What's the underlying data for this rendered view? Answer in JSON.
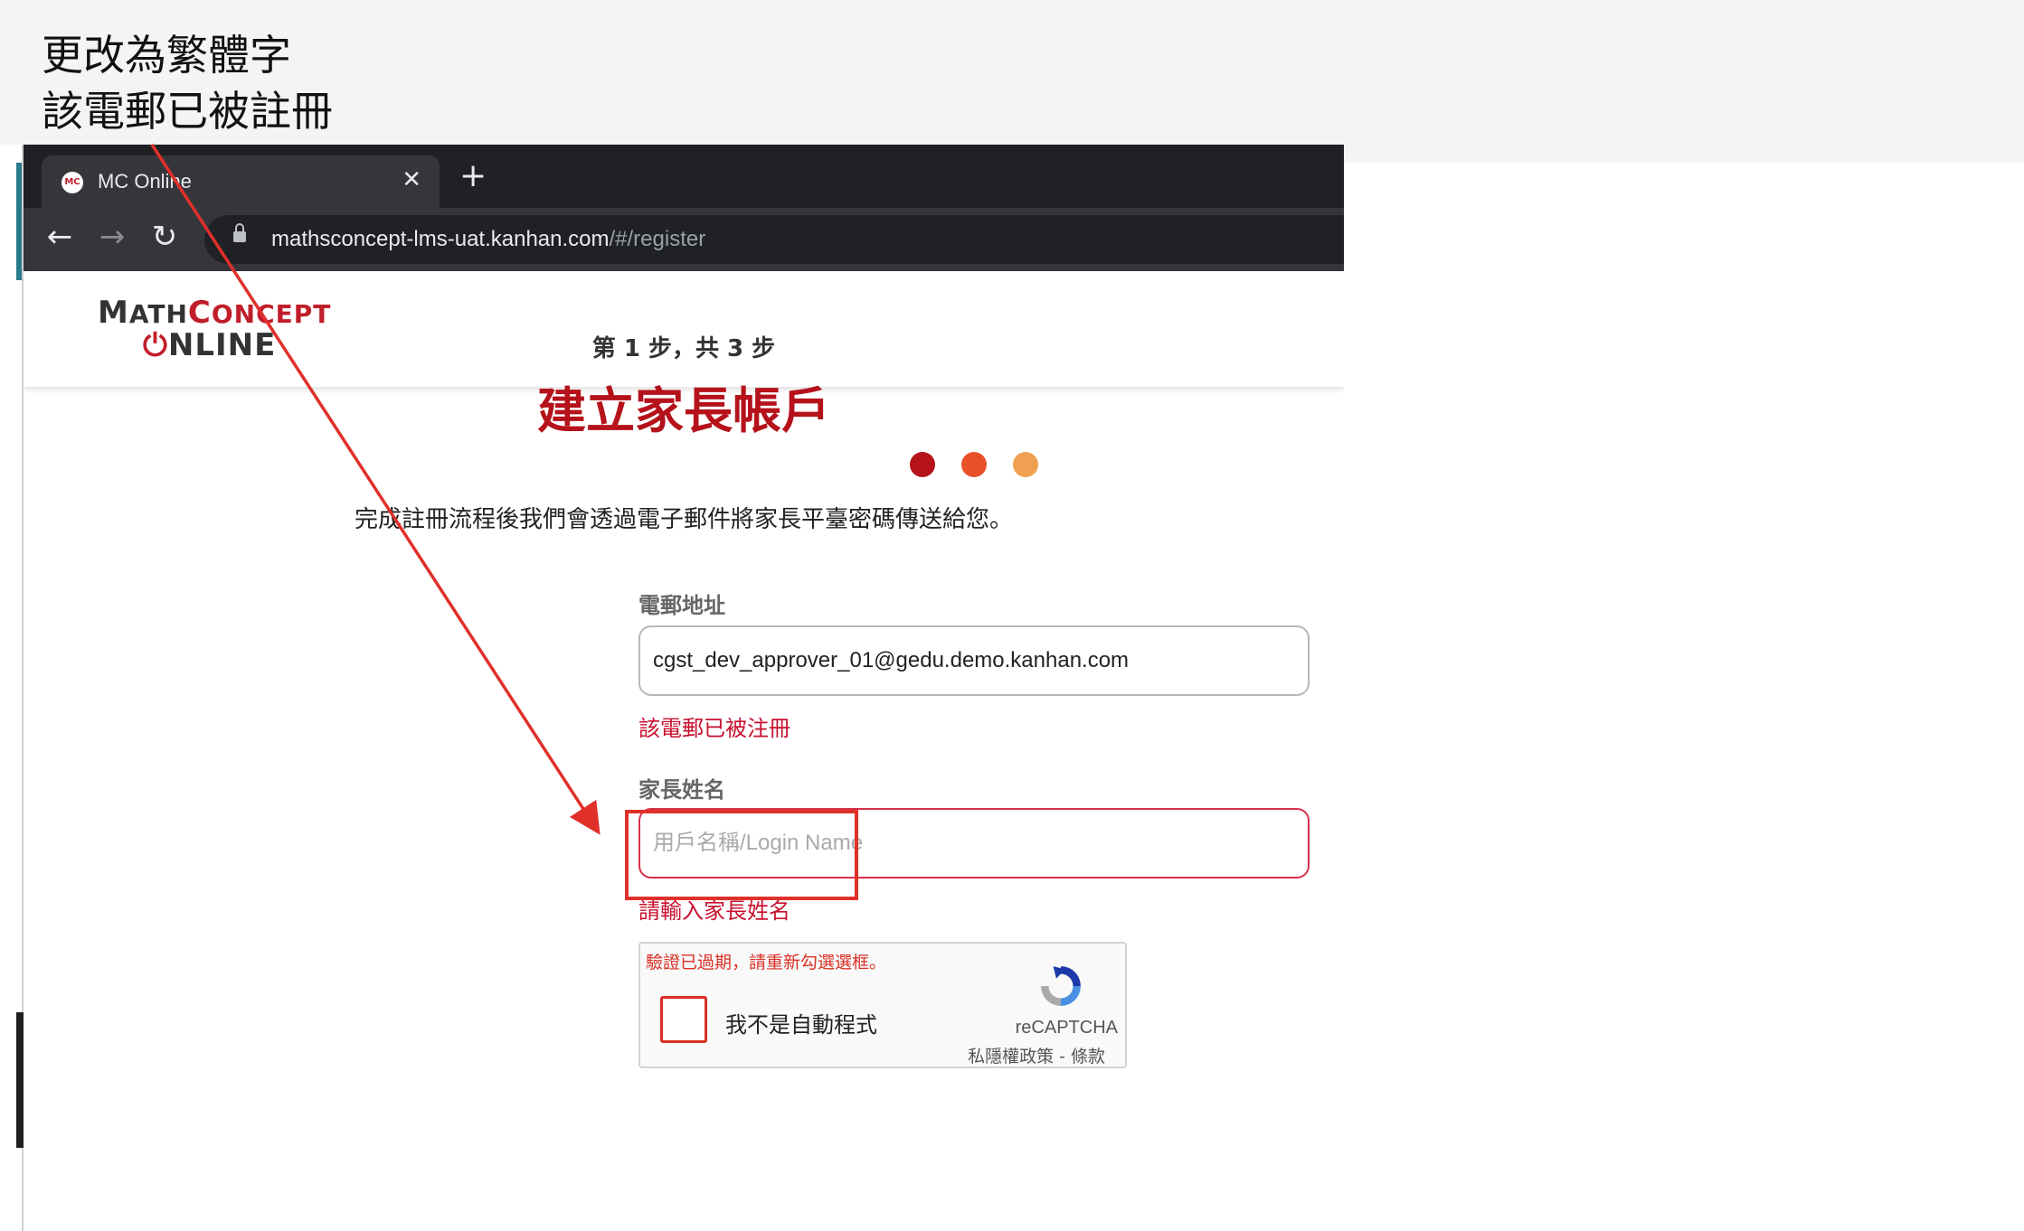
{
  "annotation": {
    "lines": [
      "更改為繁體字",
      "該電郵已被註冊"
    ]
  },
  "browser": {
    "tab_title": "MC Online",
    "favicon_text": "MC",
    "tab_close": "✕",
    "new_tab": "+",
    "url_host": "mathsconcept-lms-uat.kanhan.com",
    "url_path": "/#/register",
    "back": "←",
    "forward": "→",
    "reload": "↻"
  },
  "logo": {
    "line1_a": "M",
    "line1_b": "ATH",
    "line1_c": "C",
    "line1_d": "ONCEPT",
    "power": "⏻",
    "line2": "NLINE"
  },
  "form": {
    "step": "第 1 步，共 3 步",
    "title": "建立家長帳戶",
    "subtitle": "完成註冊流程後我們會透過電子郵件將家長平臺密碼傳送給您。",
    "email_label": "電郵地址",
    "email_value": "cgst_dev_approver_01@gedu.demo.kanhan.com",
    "email_error": "該電郵已被注冊",
    "name_label": "家長姓名",
    "name_placeholder": "用戶名稱/Login Name",
    "name_error": "請輸入家長姓名"
  },
  "steps_dots": {
    "colors": [
      "#b5121b",
      "#e8502a",
      "#f0a050"
    ]
  },
  "recaptcha": {
    "expired": "驗證已過期，請重新勾選選框。",
    "label": "我不是自動程式",
    "brand": "reCAPTCHA",
    "links": "私隱權政策 - 條款"
  },
  "colors": {
    "accent_red": "#b5121b",
    "error_red": "#c8102e",
    "annotation_red": "#e0302a"
  }
}
